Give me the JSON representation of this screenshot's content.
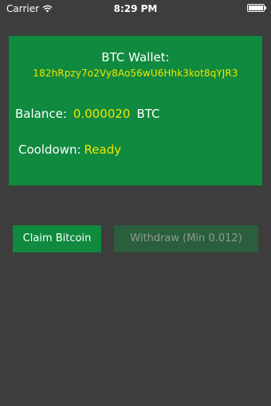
{
  "status_bar": {
    "carrier": "Carrier",
    "time": "8:29 PM",
    "wifi_icon": "wifi-icon",
    "battery_icon": "battery-icon"
  },
  "wallet": {
    "title": "BTC Wallet:",
    "address": "182hRpzy7o2Vy8Ao56wU6Hhk3kot8qYJR3",
    "balance_label": "Balance:",
    "balance_value": "0.000020",
    "balance_unit": "BTC",
    "cooldown_label": "Cooldown:",
    "cooldown_value": "Ready"
  },
  "actions": {
    "claim_label": "Claim Bitcoin",
    "withdraw_label": "Withdraw (Min 0.012)"
  },
  "colors": {
    "background": "#3d3d3d",
    "accent_green": "#0f8a3e",
    "disabled_green": "#2a5e3c",
    "highlight_yellow": "#f2e600"
  }
}
